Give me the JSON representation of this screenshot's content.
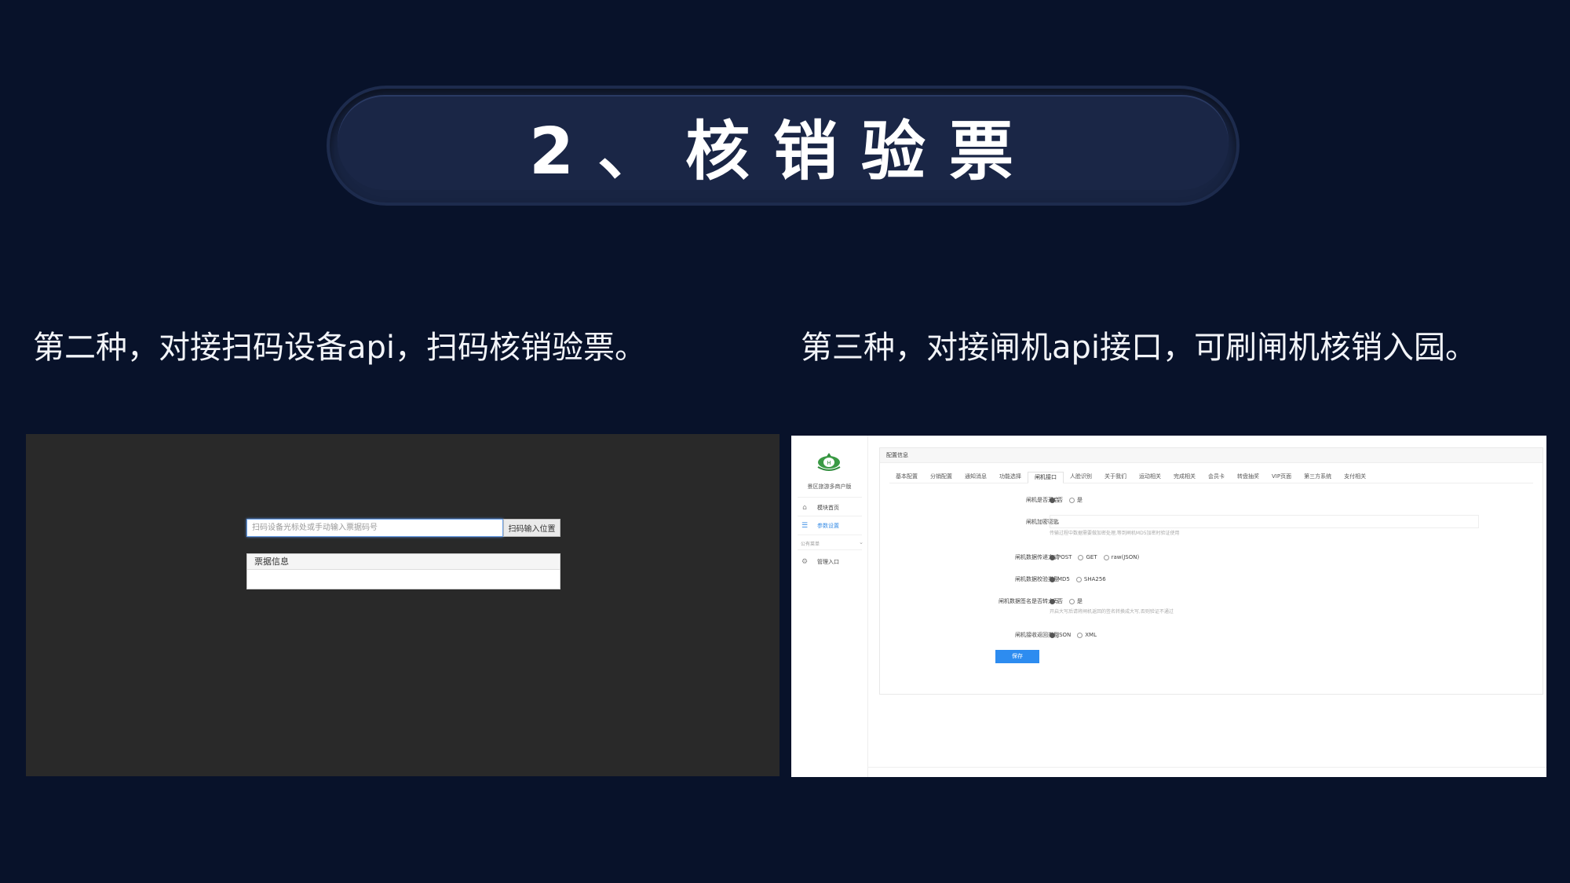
{
  "slide": {
    "title": "2、核销验票",
    "caption_left": "第二种，对接扫码设备api，扫码核销验票。",
    "caption_right": "第三种，对接闸机api接口，可刷闸机核销入园。"
  },
  "scan_app": {
    "input_placeholder": "扫码设备光标处或手动输入票据码号",
    "scan_button": "扫码输入位置",
    "ticket_info_label": "票据信息"
  },
  "admin_app": {
    "brand": "景区旅游多商户版",
    "sidebar": {
      "items": [
        {
          "label": "模块首页",
          "icon": "home-icon"
        },
        {
          "label": "参数设置",
          "icon": "list-icon",
          "active": true
        }
      ],
      "group_label": "公有菜单",
      "group_items": [
        {
          "label": "管理入口",
          "icon": "gear-icon"
        }
      ]
    },
    "panel_title": "配置信息",
    "tabs": [
      "基本配置",
      "分销配置",
      "通知消息",
      "功能选择",
      "闸机接口",
      "人脸识别",
      "关于我们",
      "运动相关",
      "完成相关",
      "会员卡",
      "转盘抽奖",
      "VIP页面",
      "第三方系统",
      "支付相关"
    ],
    "active_tab": "闸机接口",
    "fields": {
      "enable_label": "闸机是否开启",
      "enable_options": [
        "否",
        "是"
      ],
      "key_label": "闸机加密密匙",
      "key_help": "传输过程中数据需要做加密处理,等到闸机MD5加密时验证使用",
      "method_label": "闸机数据传递方式",
      "method_options": [
        "POST",
        "GET",
        "raw(JSON)"
      ],
      "sign_label": "闸机数据校验类型",
      "sign_options": [
        "MD5",
        "SHA256"
      ],
      "case_label": "闸机数据签名是否转大写",
      "case_options": [
        "否",
        "是"
      ],
      "case_help": "开启大写后请将闸机返回的签名转换成大写,否则验证不通过",
      "return_label": "闸机接收返回类型",
      "return_options": [
        "JSON",
        "XML"
      ]
    },
    "save_button": "保存"
  },
  "colors": {
    "background": "#08122a",
    "title_pill": "#182442",
    "accent_blue": "#2d8cf0"
  }
}
